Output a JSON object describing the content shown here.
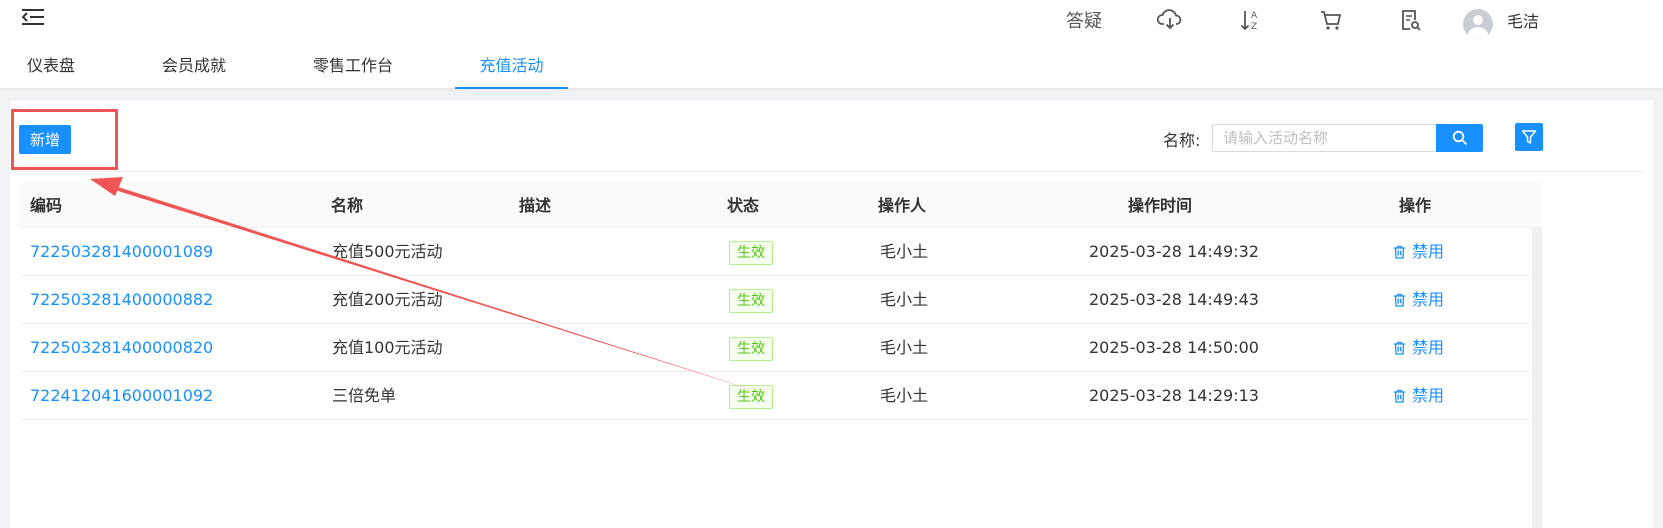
{
  "header": {
    "help_label": "答疑",
    "icons": [
      "cloud-download-icon",
      "sort-az-icon",
      "cart-icon",
      "document-search-icon",
      "avatar"
    ],
    "username": "毛洁"
  },
  "tabs": [
    {
      "label": "仪表盘",
      "active": false
    },
    {
      "label": "会员成就",
      "active": false
    },
    {
      "label": "零售工作台",
      "active": false
    },
    {
      "label": "充值活动",
      "active": true
    }
  ],
  "toolbar": {
    "add_label": "新增",
    "search_label": "名称:",
    "search_placeholder": "请输入活动名称"
  },
  "table": {
    "columns": [
      "编码",
      "名称",
      "描述",
      "状态",
      "操作人",
      "操作时间",
      "操作"
    ],
    "rows": [
      {
        "code": "722503281400001089",
        "name": "充值500元活动",
        "desc": "",
        "status": "生效",
        "operator": "毛小土",
        "time": "2025-03-28 14:49:32",
        "action": "禁用"
      },
      {
        "code": "722503281400000882",
        "name": "充值200元活动",
        "desc": "",
        "status": "生效",
        "operator": "毛小土",
        "time": "2025-03-28 14:49:43",
        "action": "禁用"
      },
      {
        "code": "722503281400000820",
        "name": "充值100元活动",
        "desc": "",
        "status": "生效",
        "operator": "毛小土",
        "time": "2025-03-28 14:50:00",
        "action": "禁用"
      },
      {
        "code": "722412041600001092",
        "name": "三倍免单",
        "desc": "",
        "status": "生效",
        "operator": "毛小土",
        "time": "2025-03-28 14:29:13",
        "action": "禁用"
      }
    ]
  },
  "colors": {
    "accent": "#1890ff",
    "annotation": "#f05555",
    "status_green": "#52c41a"
  }
}
